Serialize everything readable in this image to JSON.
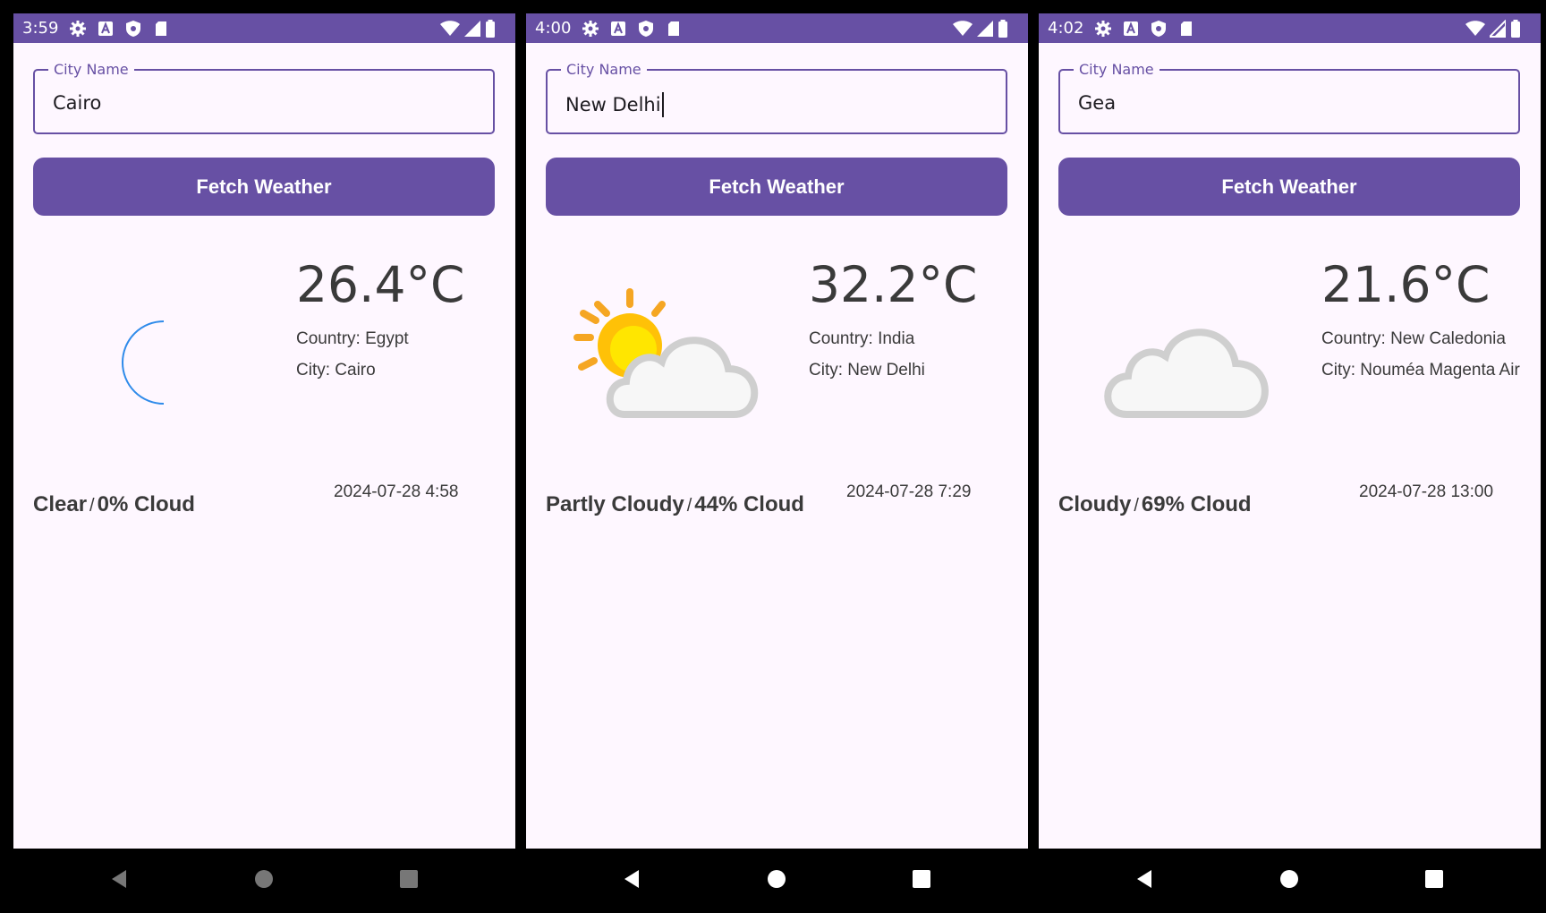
{
  "field_label": "City Name",
  "button_label": "Fetch Weather",
  "cloud_suffix": "% Cloud",
  "screens": [
    {
      "status_time": "3:59",
      "city_input": "Cairo",
      "temperature": "26.4°C",
      "country": "Country: Egypt",
      "city": "City: Cairo",
      "condition": "Clear",
      "cloud": "0% Cloud",
      "date": "2024-07-28 4:58",
      "icon": "moon-icon",
      "nav_color": "#777777"
    },
    {
      "status_time": "4:00",
      "city_input": "New Delhi",
      "temperature": "32.2°C",
      "country": "Country: India",
      "city": "City: New Delhi",
      "condition": "Partly Cloudy",
      "cloud": "44% Cloud",
      "date": "2024-07-28 7:29",
      "icon": "partly-cloudy-icon",
      "nav_color": "#ffffff"
    },
    {
      "status_time": "4:02",
      "city_input": "Gea",
      "temperature": "21.6°C",
      "country": "Country: New Caledonia",
      "city": "City: Nouméa Magenta Air",
      "condition": "Cloudy",
      "cloud": "69% Cloud",
      "date": "2024-07-28 13:00",
      "icon": "cloud-icon",
      "nav_color": "#ffffff"
    }
  ],
  "colors": {
    "primary": "#6750A4",
    "background": "#FEF7FF",
    "moon": "#0A6FD6",
    "sun": "#FFC107"
  }
}
